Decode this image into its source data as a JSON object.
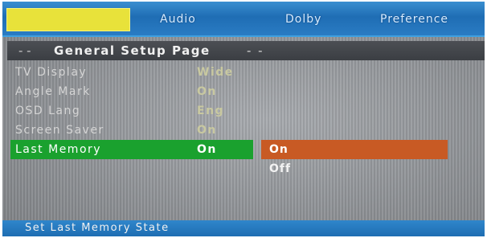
{
  "tabs": [
    {
      "label": "",
      "active": true
    },
    {
      "label": "Audio",
      "active": false
    },
    {
      "label": "Dolby",
      "active": false
    },
    {
      "label": "Preference",
      "active": false
    }
  ],
  "page_header": {
    "lead": "- -",
    "title": "General Setup Page",
    "tail": "- -"
  },
  "settings": [
    {
      "label": "TV Display",
      "value": "Wide"
    },
    {
      "label": "Angle Mark",
      "value": "On"
    },
    {
      "label": "OSD Lang",
      "value": "Eng"
    },
    {
      "label": "Screen Saver",
      "value": "On"
    },
    {
      "label": "Last Memory",
      "value": "On",
      "selected": true
    }
  ],
  "options": [
    {
      "label": "On",
      "highlighted": true
    },
    {
      "label": "Off",
      "highlighted": false
    }
  ],
  "status": "Set Last Memory State",
  "colors": {
    "tab_active": "#e8e23a",
    "selected_row": "#1aa12e",
    "option_highlight": "#c85a24",
    "value_text": "#f0e040",
    "bar_blue": "#1f6db4"
  }
}
